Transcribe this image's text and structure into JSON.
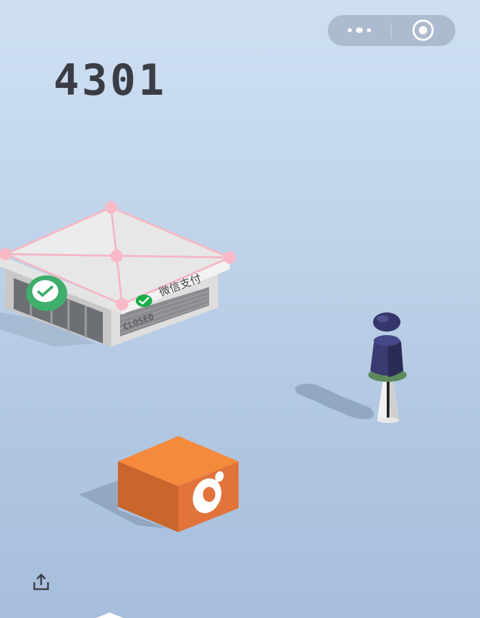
{
  "game": {
    "score": "4301"
  },
  "capsule": {
    "more_icon": "more-dots-icon",
    "close_icon": "target-circle-icon"
  },
  "store": {
    "sign_text": "微信支付",
    "closed_text": "CLOSED",
    "logo_icon": "wechat-pay-logo"
  },
  "cube": {
    "logo_icon": "eye-logo",
    "color": "#f08030"
  },
  "share": {
    "icon": "share-icon"
  }
}
